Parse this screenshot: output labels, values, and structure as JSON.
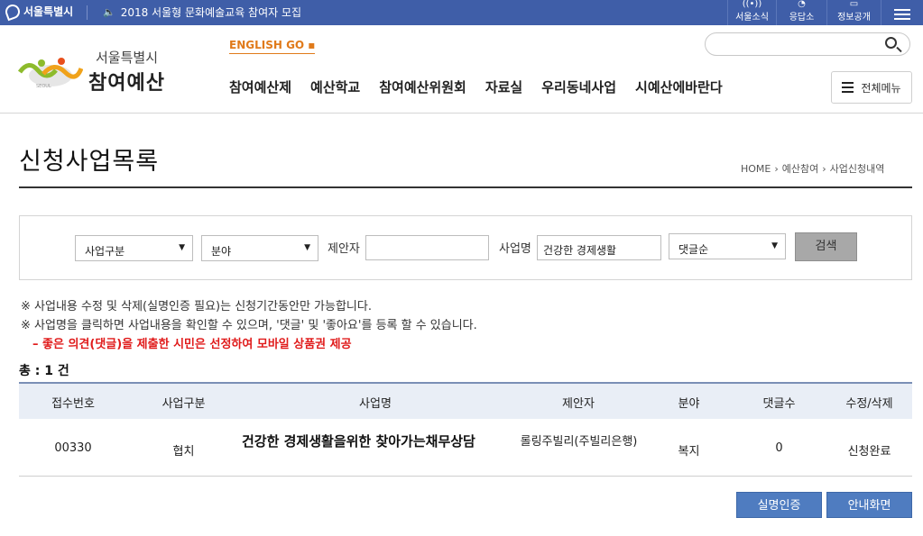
{
  "topbar": {
    "brand": "서울특별시",
    "notice": "2018 서울형 문화예술교육 참여자 모집",
    "utils": [
      "서울소식",
      "응답소",
      "정보공개"
    ]
  },
  "header": {
    "logo_sub": "서울특별시",
    "logo_main": "참여예산",
    "english": "ENGLISH GO",
    "search_placeholder": "",
    "nav": [
      "참여예산제",
      "예산학교",
      "참여예산위원회",
      "자료실",
      "우리동네사업",
      "시예산에바란다"
    ],
    "all_menu": "전체메뉴"
  },
  "page": {
    "title": "신청사업목록",
    "breadcrumb": [
      "HOME",
      "예산참여",
      "사업신청내역"
    ]
  },
  "filters": {
    "category": "사업구분",
    "field": "분야",
    "proposer_label": "제안자",
    "proposer_value": "",
    "name_label": "사업명",
    "name_value": "건강한 경제생활",
    "sort": "댓글순",
    "search_button": "검색"
  },
  "notes": [
    "※ 사업내용 수정 및 삭제(실명인증 필요)는 신청기간동안만 가능합니다.",
    "※ 사업명을 클릭하면 사업내용을 확인할 수 있으며, '댓글' 및 '좋아요'를 등록 할 수 있습니다.",
    "– 좋은 의견(댓글)을 제출한 시민은 선정하여 모바일 상품권 제공"
  ],
  "total": "총 : 1 건",
  "table": {
    "headers": [
      "접수번호",
      "사업구분",
      "사업명",
      "제안자",
      "분야",
      "댓글수",
      "수정/삭제"
    ],
    "rows": [
      {
        "no": "00330",
        "type": "협치",
        "name": "건강한 경제생활을위한 찾아가는채무상담",
        "proposer": "롤링주빌리(주빌리은행)",
        "field": "복지",
        "comments": "0",
        "status": "신청완료"
      }
    ]
  },
  "buttons": {
    "auth": "실명인증",
    "guide": "안내화면"
  }
}
